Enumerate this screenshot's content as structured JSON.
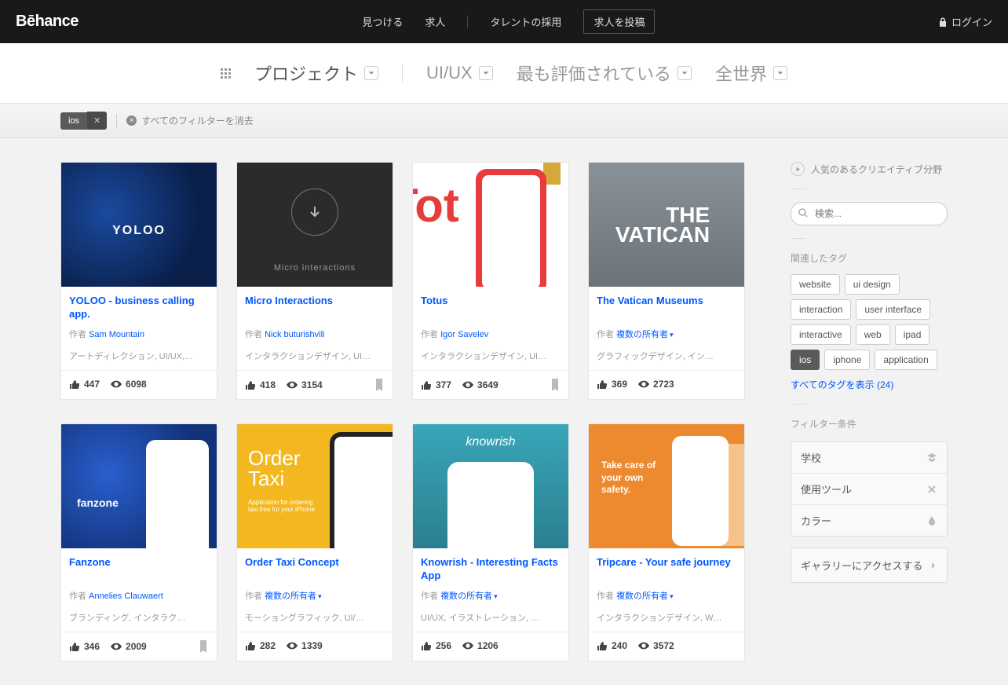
{
  "topnav": {
    "logo": "Bēhance",
    "discover": "見つける",
    "jobs": "求人",
    "hire": "タレントの採用",
    "post_job": "求人を投稿",
    "login": "ログイン"
  },
  "filterbar": {
    "projects": "プロジェクト",
    "field": "UI/UX",
    "sort": "最も評価されている",
    "region": "全世界"
  },
  "tagbar": {
    "tag": "ios",
    "clear_all": "すべてのフィルターを消去"
  },
  "by_label": "作者",
  "multi_owners": "複数の所有者",
  "projects": [
    {
      "title": "YOLOO - business calling app.",
      "author": "Sam Mountain",
      "multi": false,
      "cats": "アートディレクション, UI/UX,…",
      "likes": "447",
      "views": "6098",
      "flag": false,
      "ribbon": false,
      "thumb": "t-yoloo"
    },
    {
      "title": "Micro Interactions",
      "author": "Nick buturishvili",
      "multi": false,
      "cats": "インタラクションデザイン, UI…",
      "likes": "418",
      "views": "3154",
      "flag": true,
      "ribbon": false,
      "thumb": "t-micro"
    },
    {
      "title": "Totus",
      "author": "Igor Savelev",
      "multi": false,
      "cats": "インタラクションデザイン, UI…",
      "likes": "377",
      "views": "3649",
      "flag": true,
      "ribbon": true,
      "thumb": "t-totus"
    },
    {
      "title": "The Vatican Museums",
      "author": "",
      "multi": true,
      "cats": "グラフィックデザイン, イン…",
      "likes": "369",
      "views": "2723",
      "flag": false,
      "ribbon": false,
      "thumb": "t-vatican"
    },
    {
      "title": "Fanzone",
      "author": "Annelies Clauwaert",
      "multi": false,
      "cats": "ブランディング, インタラク…",
      "likes": "346",
      "views": "2009",
      "flag": true,
      "ribbon": false,
      "thumb": "t-fanzone"
    },
    {
      "title": "Order Taxi Concept",
      "author": "",
      "multi": true,
      "cats": "モーショングラフィック, UI/…",
      "likes": "282",
      "views": "1339",
      "flag": false,
      "ribbon": false,
      "thumb": "t-order"
    },
    {
      "title": "Knowrish - Interesting Facts App",
      "author": "",
      "multi": true,
      "cats": "UI/UX, イラストレーション, …",
      "likes": "256",
      "views": "1206",
      "flag": false,
      "ribbon": false,
      "thumb": "t-know"
    },
    {
      "title": "Tripcare - Your safe journey",
      "author": "",
      "multi": true,
      "cats": "インタラクションデザイン, W…",
      "likes": "240",
      "views": "3572",
      "flag": false,
      "ribbon": false,
      "thumb": "t-trip"
    }
  ],
  "sidebar": {
    "popular_fields": "人気のあるクリエイティブ分野",
    "search_placeholder": "検索...",
    "related_label": "関連したタグ",
    "tags": [
      "website",
      "ui design",
      "interaction",
      "user interface",
      "interactive",
      "web",
      "ipad",
      "ios",
      "iphone",
      "application"
    ],
    "active_tag": "ios",
    "show_all": "すべてのタグを表示 (24)",
    "refine_label": "フィルター条件",
    "refine": {
      "school": "学校",
      "tools": "使用ツール",
      "color": "カラー"
    },
    "gallery_access": "ギャラリーにアクセスする"
  }
}
